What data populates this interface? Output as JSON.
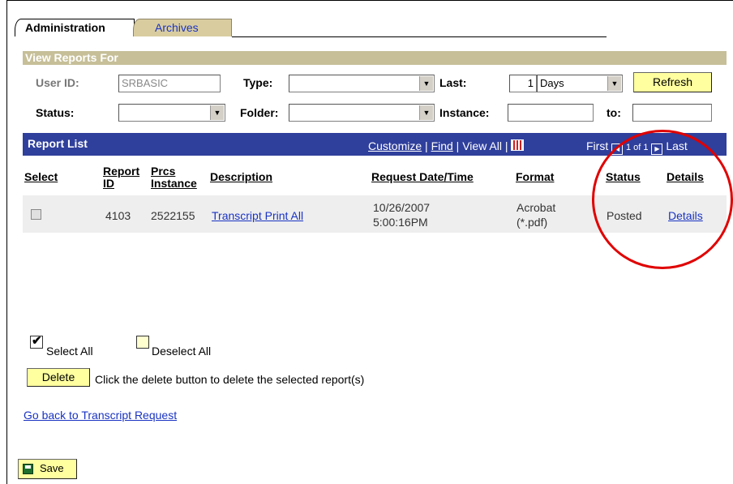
{
  "tabs": [
    {
      "label": "Administration",
      "active": true
    },
    {
      "label": "Archives",
      "active": false
    }
  ],
  "filter": {
    "section_title": "View Reports For",
    "user_id_label": "User ID:",
    "user_id_value": "SRBASIC",
    "type_label": "Type:",
    "type_value": "",
    "last_label": "Last:",
    "last_value": "1",
    "last_unit": "Days",
    "refresh_label": "Refresh",
    "status_label": "Status:",
    "status_value": "",
    "folder_label": "Folder:",
    "folder_value": "",
    "instance_label": "Instance:",
    "instance_value": "",
    "to_label": "to:",
    "to_value": ""
  },
  "report_list": {
    "title": "Report List",
    "customize": "Customize",
    "find": "Find",
    "view_all": "View All",
    "first": "First",
    "page_info": "1 of 1",
    "last": "Last",
    "columns": {
      "select": "Select",
      "report_id_1": "Report",
      "report_id_2": "ID",
      "prcs_1": "Prcs",
      "prcs_2": "Instance",
      "description": "Description",
      "request": "Request Date/Time",
      "format": "Format",
      "status": "Status",
      "details": "Details"
    },
    "rows": [
      {
        "report_id": "4103",
        "prcs_instance": "2522155",
        "description": "Transcript Print All",
        "date": "10/26/2007",
        "time": "5:00:16PM",
        "format_1": "Acrobat",
        "format_2": "(*.pdf)",
        "status": "Posted",
        "details": "Details"
      }
    ]
  },
  "actions": {
    "select_all": "Select All",
    "deselect_all": "Deselect All",
    "delete_label": "Delete",
    "delete_hint": "Click the delete button to delete the selected report(s)",
    "go_back": "Go back to Transcript Request",
    "save_label": "Save"
  },
  "colors": {
    "grid_header": "#2f3f9c",
    "section_header": "#c6bf98",
    "button": "#ffffa0",
    "annotation_circle": "#e00000"
  }
}
